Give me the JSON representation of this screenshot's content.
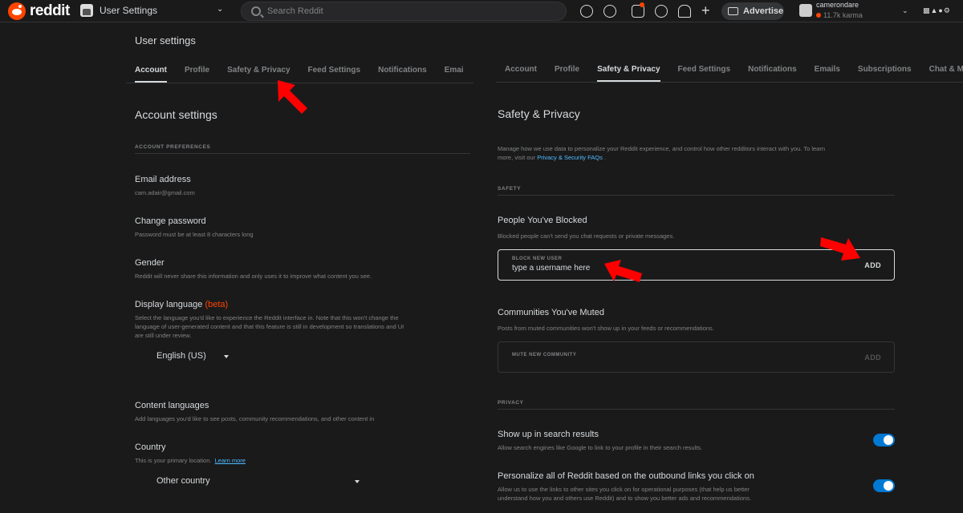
{
  "topbar": {
    "logo_text": "reddit",
    "community_label": "User Settings",
    "search_placeholder": "Search Reddit",
    "advertise_label": "Advertise",
    "username": "camerondare",
    "karma": "11.7k karma"
  },
  "left": {
    "page_title": "User settings",
    "tabs": [
      "Account",
      "Profile",
      "Safety & Privacy",
      "Feed Settings",
      "Notifications",
      "Emai"
    ],
    "active_tab": "Account",
    "heading": "Account settings",
    "section_caps": "ACCOUNT PREFERENCES",
    "email": {
      "title": "Email address",
      "desc": "cam.adair@gmail.com"
    },
    "password": {
      "title": "Change password",
      "desc": "Password must be at least 8 characters long"
    },
    "gender": {
      "title": "Gender",
      "desc": "Reddit will never share this information and only uses it to improve what content you see."
    },
    "language": {
      "title": "Display language",
      "beta": "(beta)",
      "desc_1": "Select the language you'd like to experience the Reddit interface in. Note that this won't change the",
      "desc_2": "language of user-generated content and that this feature is still in development so translations and UI",
      "desc_3": "are still under review.",
      "value": "English (US)"
    },
    "content_languages": {
      "title": "Content languages",
      "desc": "Add languages you'd like to see posts, community recommendations, and other content in"
    },
    "country": {
      "title": "Country",
      "desc": "This is your primary location.",
      "link": "Learn more",
      "value": "Other country"
    }
  },
  "right": {
    "tabs": [
      "Account",
      "Profile",
      "Safety & Privacy",
      "Feed Settings",
      "Notifications",
      "Emails",
      "Subscriptions",
      "Chat & M"
    ],
    "active_tab": "Safety & Privacy",
    "heading": "Safety & Privacy",
    "intro_1": "Manage how we use data to personalize your Reddit experience, and control how other redditors interact with you. To learn",
    "intro_2_pre": "more, visit our ",
    "intro_link": "Privacy & Security FAQs",
    "intro_2_post": " .",
    "safety_caps": "SAFETY",
    "blocked": {
      "title": "People You've Blocked",
      "desc": "Blocked people can't send you chat requests or private messages.",
      "input_label": "BLOCK NEW USER",
      "input_value": "type a username here",
      "add": "ADD"
    },
    "muted": {
      "title": "Communities You've Muted",
      "desc": "Posts from muted communities won't show up in your feeds or recommendations.",
      "input_label": "MUTE NEW COMMUNITY",
      "add": "ADD"
    },
    "privacy_caps": "PRIVACY",
    "search_results": {
      "title": "Show up in search results",
      "desc": "Allow search engines like Google to link to your profile in their search results.",
      "enabled": true
    },
    "personalize": {
      "title": "Personalize all of Reddit based on the outbound links you click on",
      "desc_1": "Allow us to use the links to other sites you click on for operational purposes (that help us better",
      "desc_2": "understand how you and others use Reddit) and to show you better ads and recommendations.",
      "enabled": true
    }
  },
  "colors": {
    "background": "#1a1a1b",
    "text": "#d7dadc",
    "muted_text": "#818384",
    "divider": "#343536",
    "accent_orange": "#ff4500",
    "toggle_blue": "#0079d3",
    "link_blue": "#4fbcff",
    "annotation_arrow": "#ff0000"
  }
}
